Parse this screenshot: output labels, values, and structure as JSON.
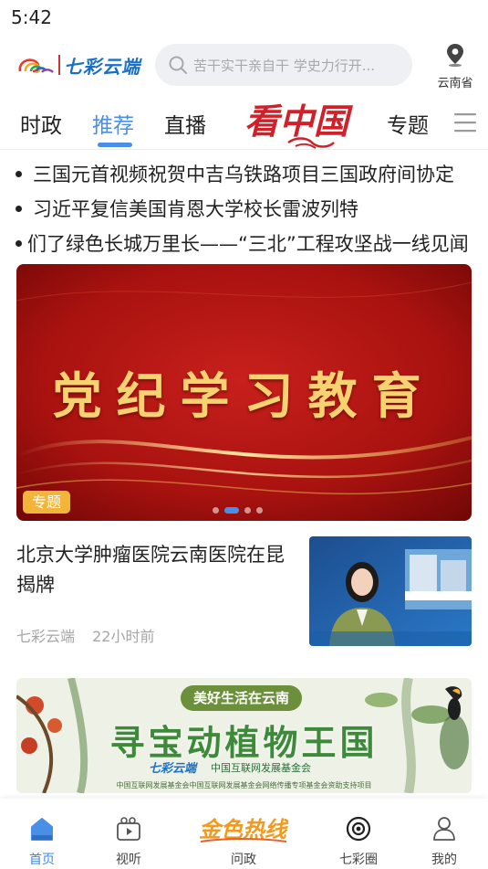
{
  "status_bar": {
    "time": "5:42"
  },
  "header": {
    "logo_text": "七彩云端",
    "search_placeholder": "苦干实干亲自干   学史力行开...",
    "location_label": "云南省"
  },
  "tabs": {
    "items": [
      {
        "label": "时政",
        "active": false
      },
      {
        "label": "推荐",
        "active": true
      },
      {
        "label": "直播",
        "active": false
      },
      {
        "label": "专题",
        "active": false
      }
    ],
    "brand_title": "看中国"
  },
  "headlines": [
    "三国元首视频祝贺中吉乌铁路项目三国政府间协定",
    "习近平复信美国肯恩大学校长雷波列特",
    "们了绿色长城万里长——“三北”工程攻坚战一线见闻"
  ],
  "banner": {
    "text": "党纪学习教育",
    "badge": "专题",
    "dots_count": 4,
    "active_dot": 1
  },
  "news_item": {
    "title": "北京大学肿瘤医院云南医院在昆揭牌",
    "source": "七彩云端",
    "time": "22小时前"
  },
  "ad": {
    "pill_text": "美好生活在云南",
    "title": "寻宝动植物王国",
    "logo_a": "七彩云端",
    "logo_b": "中国互联网发展基金会",
    "footnote": "中国互联网发展基金会中国互联网发展基金会网络传播专项基金会资助支持项目"
  },
  "bottom_nav": {
    "items": [
      {
        "label": "首页",
        "icon": "home-icon",
        "active": true
      },
      {
        "label": "视听",
        "icon": "video-icon",
        "active": false
      },
      {
        "label": "问政",
        "icon": "jinse-rexian-logo",
        "active": false
      },
      {
        "label": "七彩圈",
        "icon": "circle-icon",
        "active": false
      },
      {
        "label": "我的",
        "icon": "user-icon",
        "active": false
      }
    ],
    "center_logo_text": "金色热线"
  },
  "colors": {
    "accent": "#4a8fe7",
    "brand_red": "#d0202a",
    "badge_orange": "#f3b43a",
    "banner_gold": "#f6d271"
  }
}
